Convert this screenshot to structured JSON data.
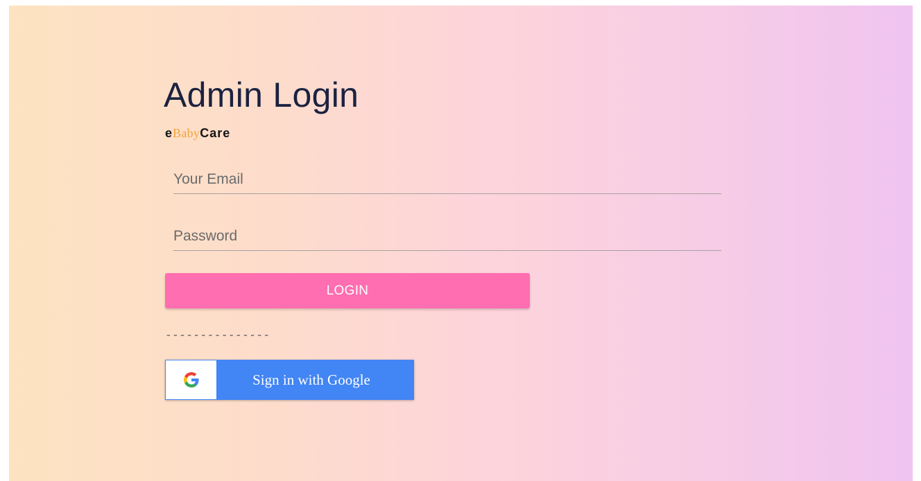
{
  "login": {
    "title": "Admin Login",
    "brand": {
      "prefix": "e",
      "accent": "Baby",
      "suffix": "Care"
    },
    "email_placeholder": "Your Email",
    "password_placeholder": "Password",
    "login_label": "LOGIN",
    "divider": "---------------",
    "google_label": "Sign in with Google"
  },
  "colors": {
    "login_button": "#ff6eb0",
    "google_button": "#4285f4",
    "brand_accent": "#f3a23c",
    "title": "#1b2240"
  },
  "icons": {
    "google": "google-g-icon"
  }
}
